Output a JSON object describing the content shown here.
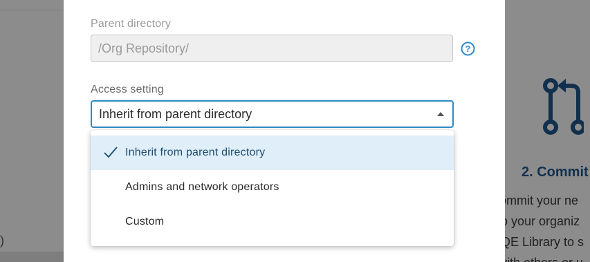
{
  "background": {
    "left_fragment": ")",
    "step": {
      "title": "2. Commit",
      "lines": [
        "ommit your ne",
        "o your organiz",
        "QE Library to s",
        "vith others or u"
      ]
    }
  },
  "modal": {
    "parent_directory": {
      "label": "Parent directory",
      "value": "/Org Repository/"
    },
    "access_setting": {
      "label": "Access setting",
      "selected": "Inherit from parent directory",
      "options": [
        {
          "label": "Inherit from parent directory",
          "selected": true
        },
        {
          "label": "Admins and network operators",
          "selected": false
        },
        {
          "label": "Custom",
          "selected": false
        }
      ]
    }
  },
  "icons": {
    "help": "help-circle-icon",
    "check": "check-icon",
    "select_arrow": "caret-up-icon",
    "step": "git-pull-request-icon"
  },
  "colors": {
    "accent": "#2f8ac8",
    "selected_bg": "#dfeef8",
    "selected_text": "#1b4b73",
    "step_title": "#11304d"
  }
}
